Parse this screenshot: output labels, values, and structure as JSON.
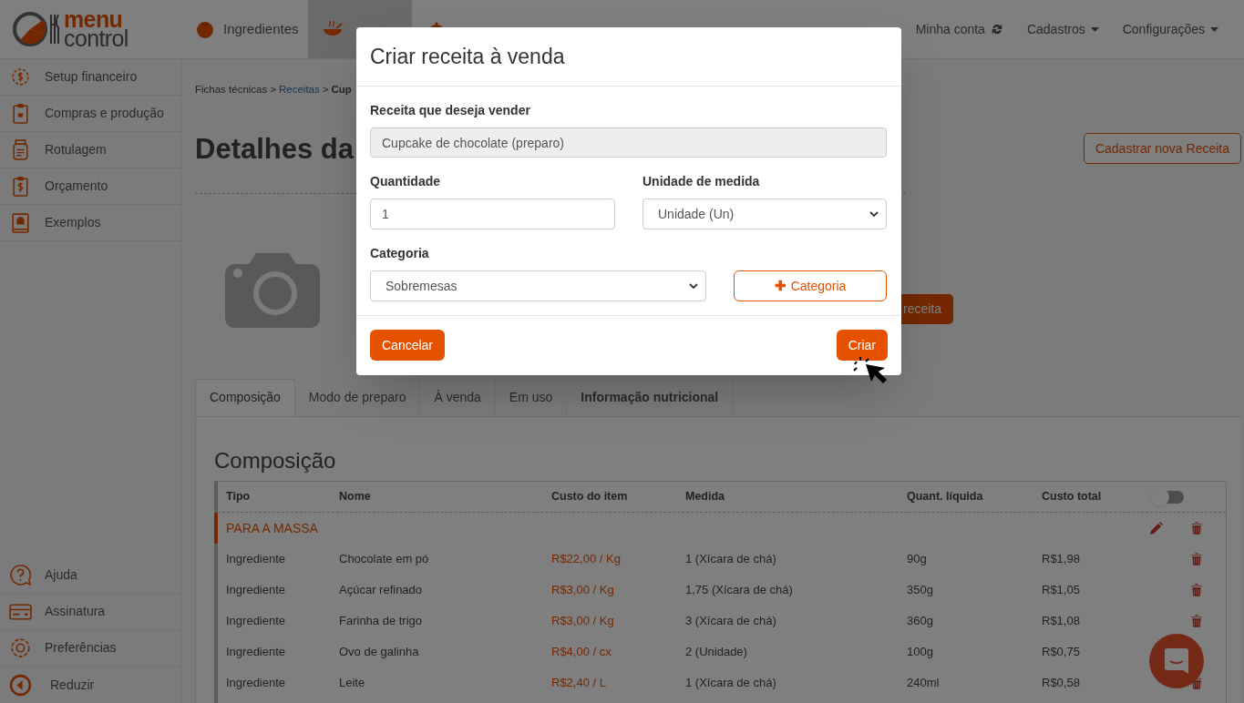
{
  "header": {
    "logo": {
      "top": "menu",
      "bottom": "control"
    },
    "nav": [
      {
        "label": "Ingredientes",
        "selected": false
      },
      {
        "selected": true
      },
      {
        "selected": false
      }
    ],
    "right_menu": [
      {
        "label": "Minha conta",
        "kind": "sync"
      },
      {
        "label": "Cadastros",
        "kind": "dropdown"
      },
      {
        "label": "Configurações",
        "kind": "dropdown"
      }
    ]
  },
  "sidebar": {
    "items": [
      {
        "label": "Setup financeiro"
      },
      {
        "label": "Compras e produção"
      },
      {
        "label": "Rotulagem"
      },
      {
        "label": "Orçamento"
      },
      {
        "label": "Exemplos"
      }
    ],
    "bottom_items": [
      {
        "label": "Ajuda"
      },
      {
        "label": "Assinatura"
      },
      {
        "label": "Preferências"
      },
      {
        "label": "Reduzir"
      }
    ]
  },
  "breadcrumb": {
    "separator": ">",
    "items": [
      {
        "label": "Fichas técnicas",
        "kind": "text"
      },
      {
        "label": "Receitas",
        "kind": "link"
      },
      {
        "label": "Cup",
        "kind": "current"
      }
    ]
  },
  "page_title": "Detalhes da",
  "new_recipe_button": "Cadastrar nova Receita",
  "recipe_button": "receita",
  "tabs": [
    {
      "label": "Composição",
      "selected": true,
      "bold": false
    },
    {
      "label": "Modo de preparo",
      "selected": false,
      "bold": false
    },
    {
      "label": "À venda",
      "selected": false,
      "bold": false
    },
    {
      "label": "Em uso",
      "selected": false,
      "bold": false
    },
    {
      "label": "Informação nutricional",
      "selected": false,
      "bold": true
    }
  ],
  "section_title": "Composição",
  "table": {
    "columns": [
      "Tipo",
      "Nome",
      "Custo do item",
      "Medida",
      "Quant. líquida",
      "Custo total"
    ],
    "toggle_on": false,
    "group": "PARA A MASSA",
    "rows": [
      [
        "Ingrediente",
        "Chocolate em pó",
        "R$22,00 / Kg",
        "1 (Xícara de chá)",
        "90g",
        "R$1,98"
      ],
      [
        "Ingrediente",
        "Açúcar refinado",
        "R$3,00 / Kg",
        "1,75 (Xícara de chá)",
        "350g",
        "R$1,05"
      ],
      [
        "Ingrediente",
        "Farinha de trigo",
        "R$3,00 / Kg",
        "3 (Xícara de chá)",
        "360g",
        "R$1,08"
      ],
      [
        "Ingrediente",
        "Ovo de galinha",
        "R$4,00 / cx",
        "2 (Unidade)",
        "100g",
        "R$0,75"
      ],
      [
        "Ingrediente",
        "Leite",
        "R$2,40 / L",
        "1 (Xícara de chá)",
        "240ml",
        "R$0,58"
      ]
    ]
  },
  "modal": {
    "title": "Criar receita à venda",
    "recipe_label": "Receita que deseja vender",
    "recipe_value": "Cupcake de chocolate (preparo)",
    "quantity_label": "Quantidade",
    "quantity_value": "1",
    "unit_label": "Unidade de medida",
    "unit_value": "Unidade (Un)",
    "category_label": "Categoria",
    "category_value": "Sobremesas",
    "add_category_icon": "✚",
    "add_category_button": "Categoria",
    "cancel_button": "Cancelar",
    "create_button": "Criar"
  }
}
